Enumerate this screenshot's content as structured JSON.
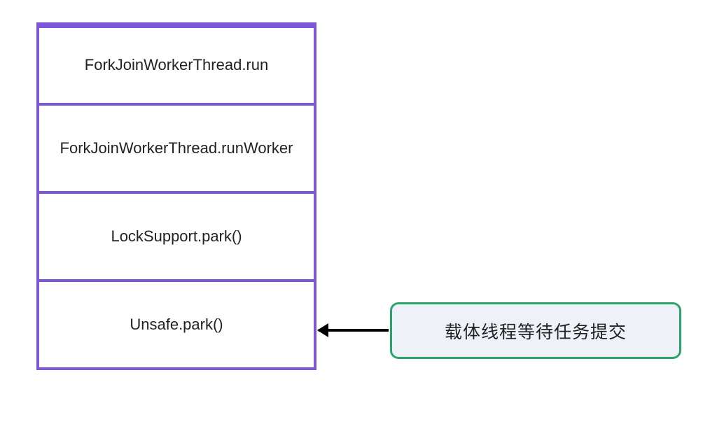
{
  "stack": {
    "frames": [
      {
        "label": "ForkJoinWorkerThread.run"
      },
      {
        "label": "ForkJoinWorkerThread.runWorker"
      },
      {
        "label": "LockSupport.park()"
      },
      {
        "label": "Unsafe.park()"
      }
    ]
  },
  "annotation": {
    "label": "载体线程等待任务提交"
  },
  "colors": {
    "stack_border": "#7e57d8",
    "annotation_border": "#2ca36a",
    "annotation_bg": "#eef2f8",
    "arrow": "#000000"
  }
}
